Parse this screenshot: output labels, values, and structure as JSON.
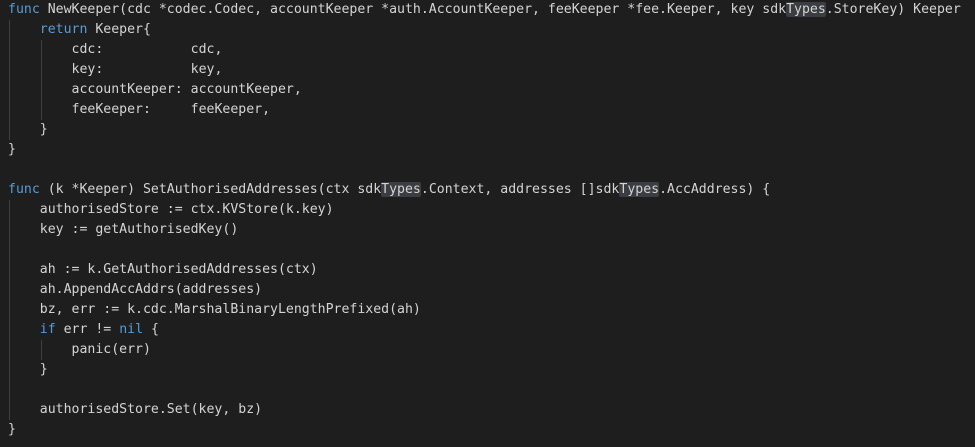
{
  "editor": {
    "theme": {
      "background": "#1e1e1e",
      "foreground": "#d4d4d4",
      "keyword": "#569cd6",
      "highlight": "#3a3d41",
      "indent_guide": "#404040"
    },
    "lines": [
      {
        "indent": 0,
        "guides": 0,
        "tokens": [
          {
            "t": "func",
            "c": "kw"
          },
          {
            "t": " NewKeeper(cdc *codec.Codec, accountKeeper *auth.AccountKeeper, feeKeeper *fee.Keeper, key sdk"
          },
          {
            "t": "Types",
            "c": "hl"
          },
          {
            "t": ".StoreKey) Keeper"
          }
        ]
      },
      {
        "indent": 4,
        "guides": 1,
        "tokens": [
          {
            "t": "return",
            "c": "kw"
          },
          {
            "t": " Keeper{"
          }
        ]
      },
      {
        "indent": 8,
        "guides": 2,
        "tokens": [
          {
            "t": "cdc:           cdc,"
          }
        ]
      },
      {
        "indent": 8,
        "guides": 2,
        "tokens": [
          {
            "t": "key:           key,"
          }
        ]
      },
      {
        "indent": 8,
        "guides": 2,
        "tokens": [
          {
            "t": "accountKeeper: accountKeeper,"
          }
        ]
      },
      {
        "indent": 8,
        "guides": 2,
        "tokens": [
          {
            "t": "feeKeeper:     feeKeeper,"
          }
        ]
      },
      {
        "indent": 4,
        "guides": 1,
        "tokens": [
          {
            "t": "}"
          }
        ]
      },
      {
        "indent": 0,
        "guides": 0,
        "tokens": [
          {
            "t": "}"
          }
        ]
      },
      {
        "indent": 0,
        "guides": 0,
        "tokens": []
      },
      {
        "indent": 0,
        "guides": 0,
        "tokens": [
          {
            "t": "func",
            "c": "kw"
          },
          {
            "t": " (k *Keeper) SetAuthorisedAddresses(ctx sdk"
          },
          {
            "t": "Types",
            "c": "hl"
          },
          {
            "t": ".Context, addresses []sdk"
          },
          {
            "t": "Types",
            "c": "hl"
          },
          {
            "t": ".AccAddress) {"
          }
        ]
      },
      {
        "indent": 4,
        "guides": 1,
        "tokens": [
          {
            "t": "authorisedStore := ctx.KVStore(k.key)"
          }
        ]
      },
      {
        "indent": 4,
        "guides": 1,
        "tokens": [
          {
            "t": "key := getAuthorisedKey()"
          }
        ]
      },
      {
        "indent": 4,
        "guides": 1,
        "tokens": []
      },
      {
        "indent": 4,
        "guides": 1,
        "tokens": [
          {
            "t": "ah := k.GetAuthorisedAddresses(ctx)"
          }
        ]
      },
      {
        "indent": 4,
        "guides": 1,
        "tokens": [
          {
            "t": "ah.AppendAccAddrs(addresses)"
          }
        ]
      },
      {
        "indent": 4,
        "guides": 1,
        "tokens": [
          {
            "t": "bz, err := k.cdc.MarshalBinaryLengthPrefixed(ah)"
          }
        ]
      },
      {
        "indent": 4,
        "guides": 1,
        "tokens": [
          {
            "t": "if",
            "c": "kw"
          },
          {
            "t": " err != "
          },
          {
            "t": "nil",
            "c": "kw"
          },
          {
            "t": " {"
          }
        ]
      },
      {
        "indent": 8,
        "guides": 2,
        "tokens": [
          {
            "t": "panic(err)"
          }
        ]
      },
      {
        "indent": 4,
        "guides": 1,
        "tokens": [
          {
            "t": "}"
          }
        ]
      },
      {
        "indent": 4,
        "guides": 1,
        "tokens": []
      },
      {
        "indent": 4,
        "guides": 1,
        "tokens": [
          {
            "t": "authorisedStore.Set(key, bz)"
          }
        ]
      },
      {
        "indent": 0,
        "guides": 0,
        "tokens": [
          {
            "t": "}"
          }
        ]
      }
    ]
  }
}
